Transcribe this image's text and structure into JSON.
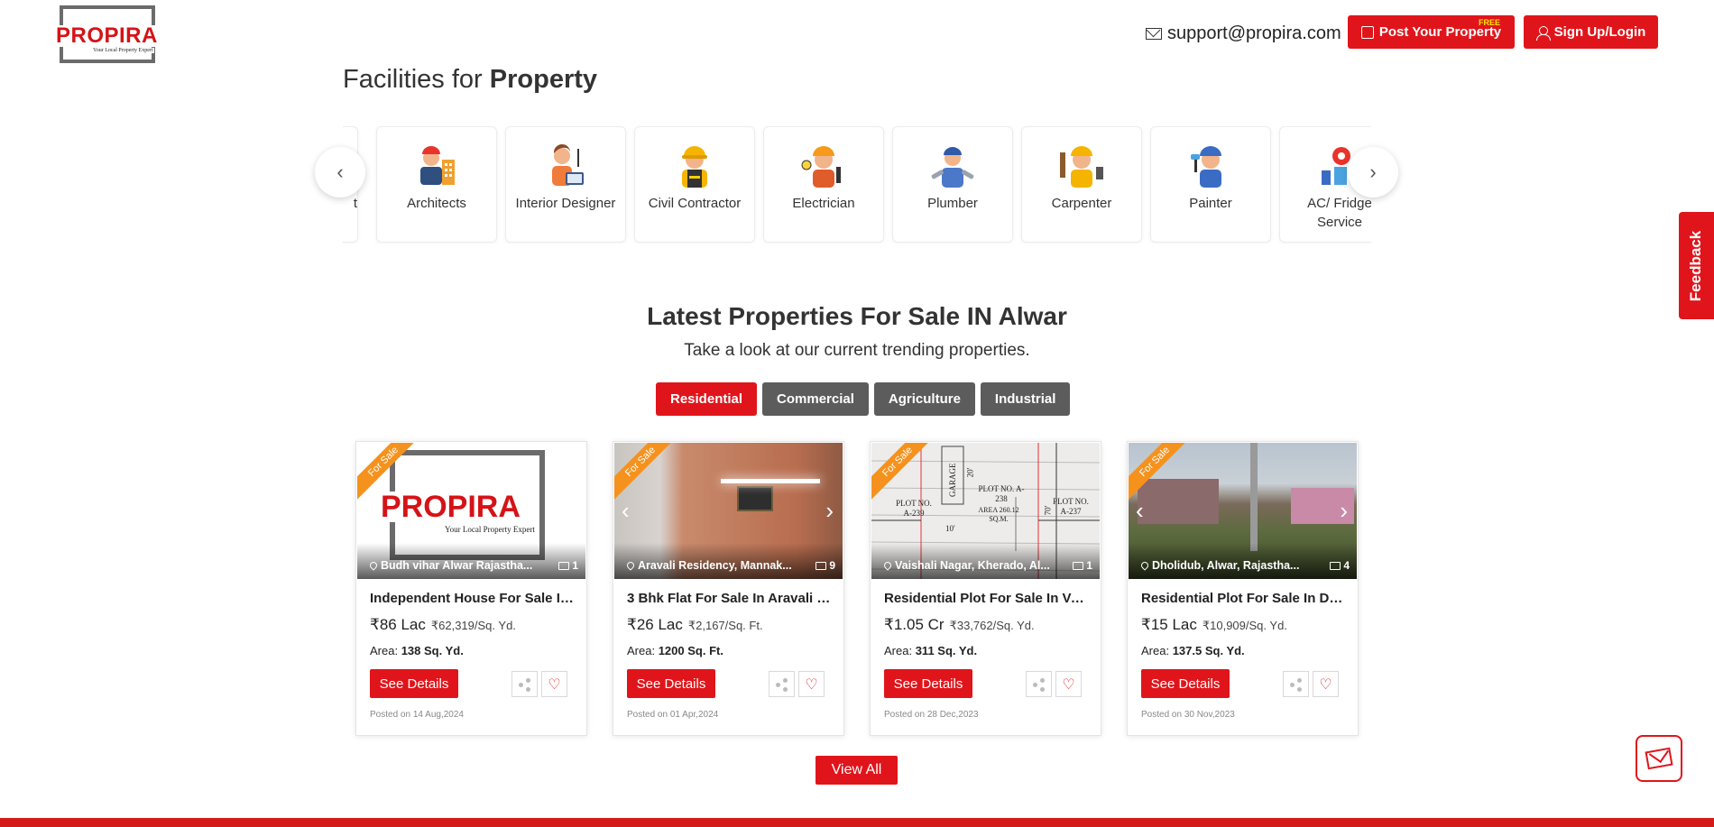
{
  "header": {
    "logo_word": "PROPIRA",
    "logo_tagline": "Your Local Property Expert",
    "support_email": "support@propira.com",
    "post_label": "Post Your Property",
    "post_badge": "FREE",
    "login_label": "Sign Up/Login"
  },
  "facilities": {
    "title_prefix": "Facilities for",
    "title_bold": "Property",
    "partial_label": "t",
    "items": [
      {
        "label": "Architects",
        "icon": "architect-icon"
      },
      {
        "label": "Interior Designer",
        "icon": "interior-designer-icon"
      },
      {
        "label": "Civil Contractor",
        "icon": "civil-contractor-icon"
      },
      {
        "label": "Electrician",
        "icon": "electrician-icon"
      },
      {
        "label": "Plumber",
        "icon": "plumber-icon"
      },
      {
        "label": "Carpenter",
        "icon": "carpenter-icon"
      },
      {
        "label": "Painter",
        "icon": "painter-icon"
      },
      {
        "label": "AC/ Fridge Service",
        "icon": "ac-fridge-service-icon"
      }
    ],
    "prev": "‹",
    "next": "›"
  },
  "feedback_label": "Feedback",
  "latest": {
    "title": "Latest Properties For Sale IN Alwar",
    "subtitle": "Take a look at our current trending properties.",
    "tabs": [
      "Residential",
      "Commercial",
      "Agriculture",
      "Industrial"
    ],
    "active_tab": "Residential",
    "ribbon": "For Sale",
    "see_details": "See Details",
    "area_label": "Area:",
    "properties": [
      {
        "location": "Budh vihar Alwar Rajastha...",
        "photos": "1",
        "title": "Independent House For Sale In ...",
        "price": "₹86 Lac",
        "rate": "₹62,319/Sq. Yd.",
        "area": "138 Sq. Yd.",
        "posted": "Posted on 14 Aug,2024"
      },
      {
        "location": "Aravali Residency, Mannak...",
        "photos": "9",
        "title": "3 Bhk Flat For Sale In Aravali Re...",
        "price": "₹26 Lac",
        "rate": "₹2,167/Sq. Ft.",
        "area": "1200 Sq. Ft.",
        "posted": "Posted on 01 Apr,2024"
      },
      {
        "location": "Vaishali Nagar, Kherado, Al...",
        "photos": "1",
        "title": "Residential Plot For Sale In Vais...",
        "price": "₹1.05 Cr",
        "rate": "₹33,762/Sq. Yd.",
        "area": "311 Sq. Yd.",
        "posted": "Posted on 28 Dec,2023"
      },
      {
        "location": "Dholidub, Alwar, Rajastha...",
        "photos": "4",
        "title": "Residential Plot For Sale In Dho...",
        "price": "₹15 Lac",
        "rate": "₹10,909/Sq. Yd.",
        "area": "137.5 Sq. Yd.",
        "posted": "Posted on 30 Nov,2023"
      }
    ],
    "plot_text": {
      "garage": "GARAGE",
      "garage_dim": "20'",
      "left_plot": "PLOT NO. A-239",
      "center_plot": "PLOT NO. A-238",
      "center_area": "AREA 260.12 SQ.M.",
      "right_plot": "PLOT NO. A-237",
      "dim_a": "10'",
      "dim_b": "70'"
    },
    "view_all": "View All"
  },
  "colors": {
    "brand_red": "#e0151b",
    "tab_gray": "#5c5c5c",
    "ribbon_orange": "#f5921e",
    "heart": "#e0151b"
  }
}
